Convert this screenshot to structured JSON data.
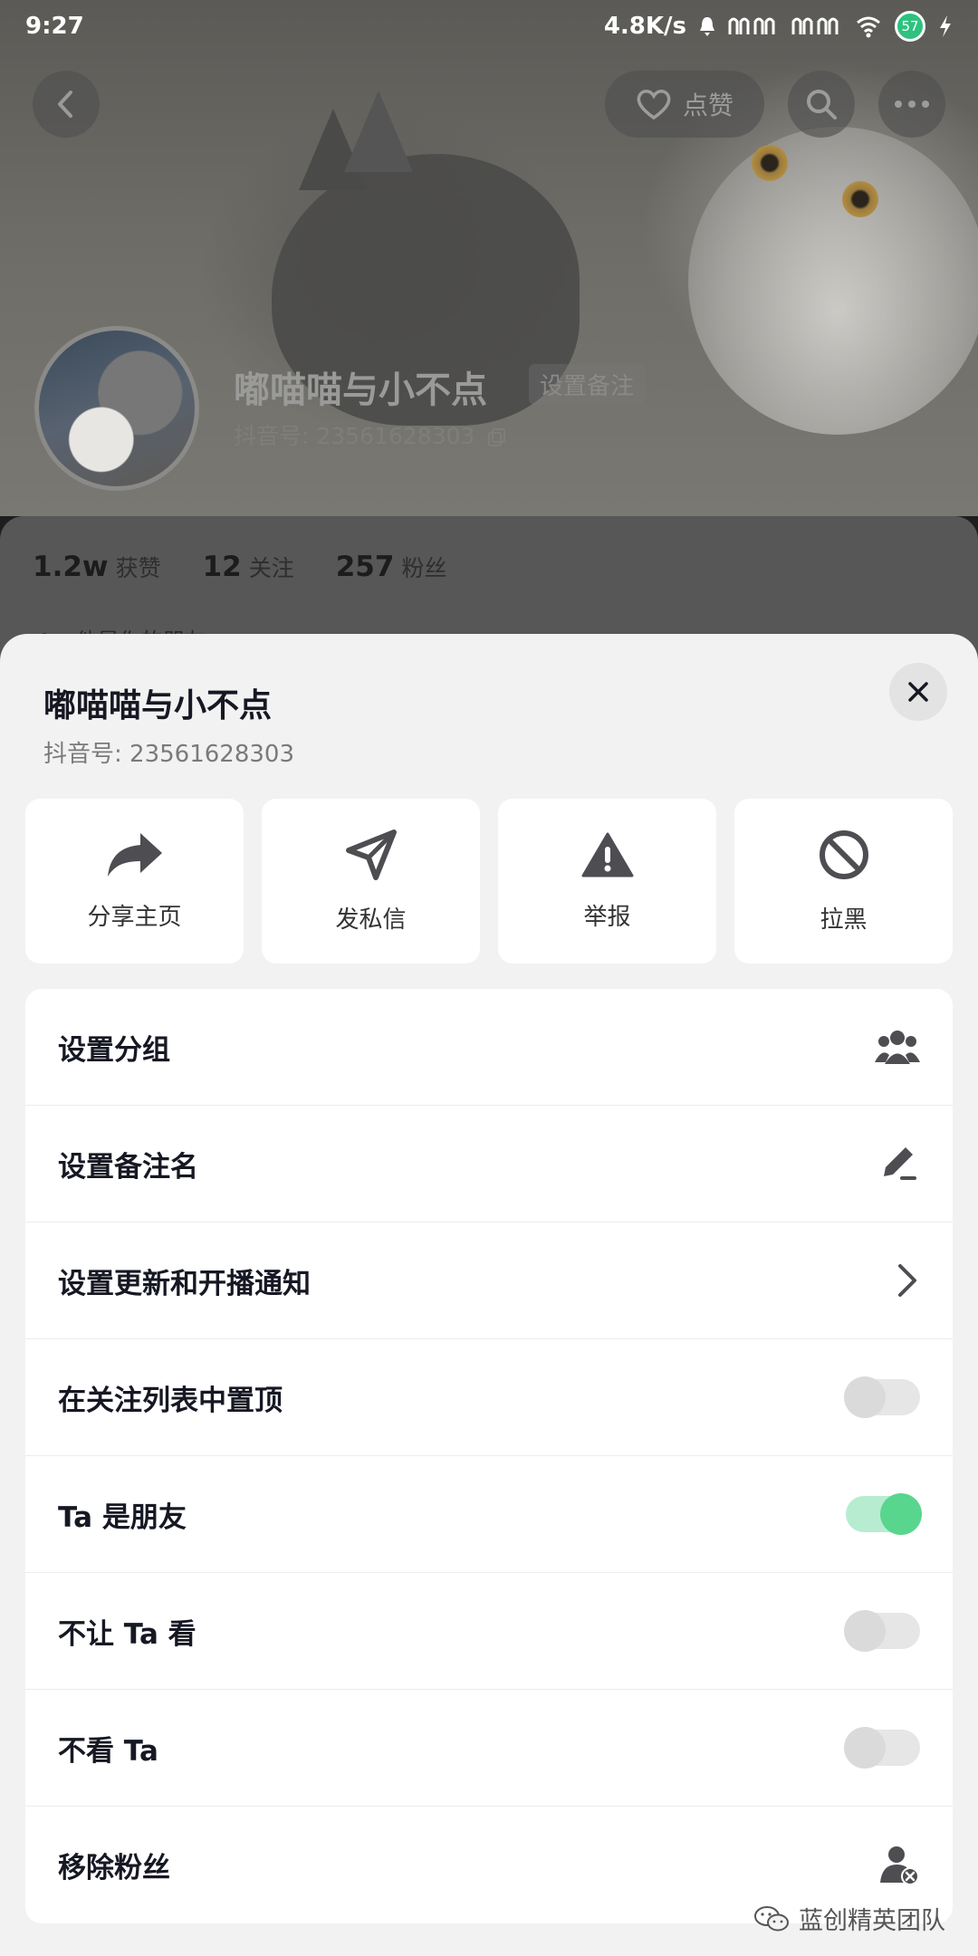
{
  "status_bar": {
    "time": "9:27",
    "net_speed": "4.8K/s",
    "battery": "57"
  },
  "hero": {
    "like_label": "点赞",
    "name": "嘟喵喵与小不点",
    "remark_button": "设置备注",
    "douyin_id": "抖音号: 23561628303"
  },
  "stats": [
    {
      "value": "1.2w",
      "label": "获赞"
    },
    {
      "value": "12",
      "label": "关注"
    },
    {
      "value": "257",
      "label": "粉丝"
    }
  ],
  "friend_hint": "他是你的朋友",
  "sheet": {
    "title": "嘟喵喵与小不点",
    "douyin_id": "抖音号: 23561628303",
    "actions": [
      {
        "label": "分享主页",
        "icon": "share-icon"
      },
      {
        "label": "发私信",
        "icon": "send-icon"
      },
      {
        "label": "举报",
        "icon": "warning-icon"
      },
      {
        "label": "拉黑",
        "icon": "block-icon"
      }
    ],
    "menu": [
      {
        "label": "设置分组",
        "control": "group-icon"
      },
      {
        "label": "设置备注名",
        "control": "edit-icon"
      },
      {
        "label": "设置更新和开播通知",
        "control": "chevron-right-icon"
      },
      {
        "label": "在关注列表中置顶",
        "control": "toggle",
        "on": false
      },
      {
        "label": "Ta 是朋友",
        "control": "toggle",
        "on": true
      },
      {
        "label": "不让 Ta 看",
        "control": "toggle",
        "on": false
      },
      {
        "label": "不看 Ta",
        "control": "toggle",
        "on": false
      },
      {
        "label": "移除粉丝",
        "control": "remove-fan-icon"
      }
    ]
  },
  "watermark": "蓝创精英团队",
  "colors": {
    "toggle_on": "#58d68d",
    "sheet_bg": "#f2f2f2",
    "text_primary": "#161823"
  }
}
